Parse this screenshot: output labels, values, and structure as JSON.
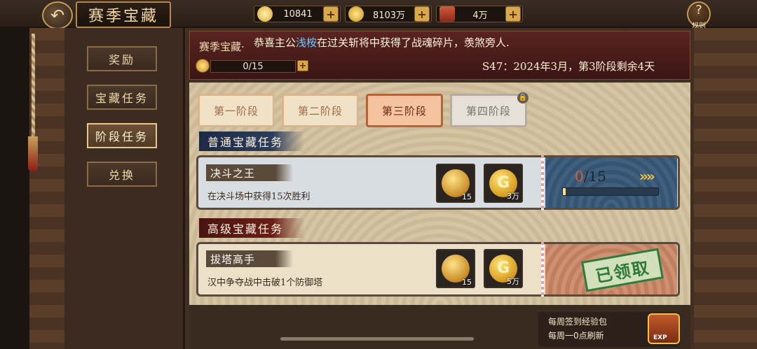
{
  "header": {
    "title": "赛季宝藏",
    "back_icon": "back-arrow-icon",
    "help_label": "规则",
    "help_glyph": "?"
  },
  "resources": [
    {
      "icon": "silver-ingot-icon",
      "value": "10841"
    },
    {
      "icon": "gold-coin-icon",
      "value": "8103万"
    },
    {
      "icon": "ticket-icon",
      "value": "4万"
    }
  ],
  "sidebar": {
    "items": [
      {
        "label": "奖励",
        "active": false
      },
      {
        "label": "宝藏任务",
        "active": false
      },
      {
        "label": "阶段任务",
        "active": true
      },
      {
        "label": "兑换",
        "active": false
      }
    ]
  },
  "panel": {
    "title": "赛季宝藏·",
    "marquee_prefix": "恭喜主公",
    "marquee_name": "浅桉",
    "marquee_suffix": "在过关斩将中获得了战魂碎片，羡煞旁人.",
    "progress": "0/15",
    "season_info": "S47：2024年3月，第3阶段剩余4天"
  },
  "stages": [
    {
      "label": "第一阶段",
      "state": "normal"
    },
    {
      "label": "第二阶段",
      "state": "normal"
    },
    {
      "label": "第三阶段",
      "state": "active"
    },
    {
      "label": "第四阶段",
      "state": "locked"
    }
  ],
  "sections": {
    "normal": "普通宝藏任务",
    "advanced": "高级宝藏任务"
  },
  "tasks": [
    {
      "name": "决斗之王",
      "desc": "在决斗场中获得15次胜利",
      "rewards": [
        {
          "icon": "treasure-token-icon",
          "qty": "15"
        },
        {
          "icon": "gold-coin-icon",
          "qty": "3万"
        }
      ],
      "progress_done": "0",
      "progress_total": "/15",
      "progress_fraction": 0,
      "arrow": "»»"
    },
    {
      "name": "拔塔高手",
      "desc": "汉中争夺战中击破1个防御塔",
      "rewards": [
        {
          "icon": "treasure-token-icon",
          "qty": "15"
        },
        {
          "icon": "gold-coin-icon",
          "qty": "5万"
        }
      ],
      "status": "已领取"
    }
  ],
  "weekly": {
    "title": "每周签到经验包",
    "subtitle": "每周一0点刷新",
    "chest_label": "EXP"
  },
  "lock_glyph": "🔒",
  "plus_glyph": "+",
  "colors": {
    "active_stage": "#f4c3a0",
    "claimed_green": "#2e7a3a",
    "highlight_name": "#6ec8ff"
  }
}
